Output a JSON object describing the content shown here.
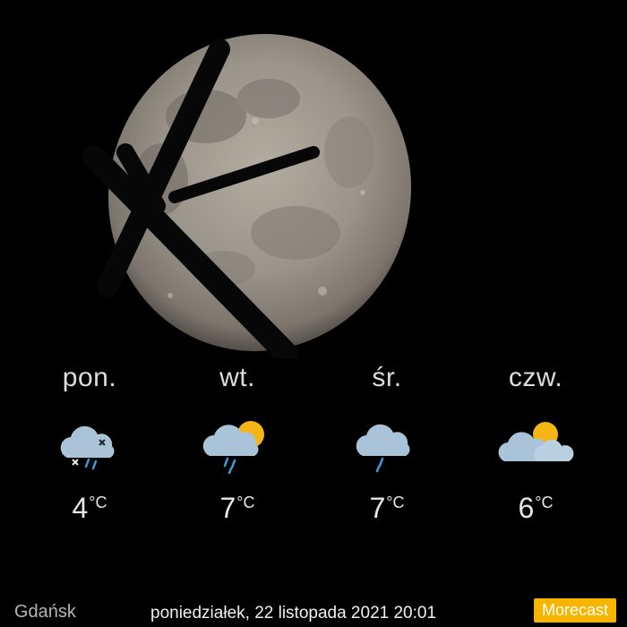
{
  "colors": {
    "background": "#000000",
    "brand": "#f7b500",
    "cloud": "#a9c4d8",
    "sun": "#f5b514",
    "rain": "#3a9bd6",
    "snow": "#222222"
  },
  "photo": {
    "subject_icon": "moon-photo"
  },
  "forecast": [
    {
      "day": "pon.",
      "temp": "4",
      "unit": "°C",
      "icon": "cloud-rain-snow-icon"
    },
    {
      "day": "wt.",
      "temp": "7",
      "unit": "°C",
      "icon": "sun-cloud-rain-icon"
    },
    {
      "day": "śr.",
      "temp": "7",
      "unit": "°C",
      "icon": "cloud-rain-icon"
    },
    {
      "day": "czw.",
      "temp": "6",
      "unit": "°C",
      "icon": "sun-clouds-icon"
    }
  ],
  "footer": {
    "city": "Gdańsk",
    "datetime": "poniedziałek, 22 listopada 2021 20:01",
    "brand": "Morecast"
  }
}
